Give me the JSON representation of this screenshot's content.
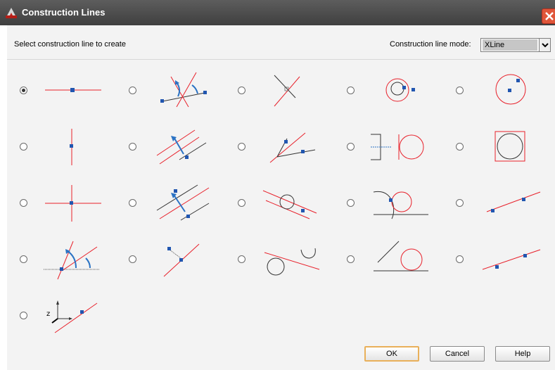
{
  "window": {
    "title": "Construction Lines"
  },
  "dialog": {
    "prompt": "Select construction line to create",
    "mode_label": "Construction line mode:",
    "mode_value": "XLine"
  },
  "options": {
    "selected_index": 0,
    "items": [
      {
        "icon": "horizontal-line-icon"
      },
      {
        "icon": "angle-bisector-icon"
      },
      {
        "icon": "perpendicular-icon"
      },
      {
        "icon": "circle-tangent-point-icon"
      },
      {
        "icon": "circle-center-point-icon"
      },
      {
        "icon": "vertical-line-icon"
      },
      {
        "icon": "parallel-offset-icon"
      },
      {
        "icon": "angle-line-icon"
      },
      {
        "icon": "line-tangent-circle-icon"
      },
      {
        "icon": "circle-square-icon"
      },
      {
        "icon": "cross-lines-icon"
      },
      {
        "icon": "parallel-through-point-icon"
      },
      {
        "icon": "line-tangent-small-circle-icon"
      },
      {
        "icon": "arc-tangent-circle-icon"
      },
      {
        "icon": "two-point-line-icon"
      },
      {
        "icon": "angle-from-reference-icon"
      },
      {
        "icon": "perpendicular-through-point-icon"
      },
      {
        "icon": "tangent-two-circles-icon"
      },
      {
        "icon": "tangent-circle-angle-icon"
      },
      {
        "icon": "two-point-line-alt-icon"
      },
      {
        "icon": "ucs-axis-line-icon"
      }
    ]
  },
  "buttons": {
    "ok": "OK",
    "cancel": "Cancel",
    "help": "Help"
  },
  "colors": {
    "construction_line": "#e8202a",
    "point": "#2156b0",
    "arrow": "#2b73c4",
    "titlebar": "#4a4a4a"
  }
}
